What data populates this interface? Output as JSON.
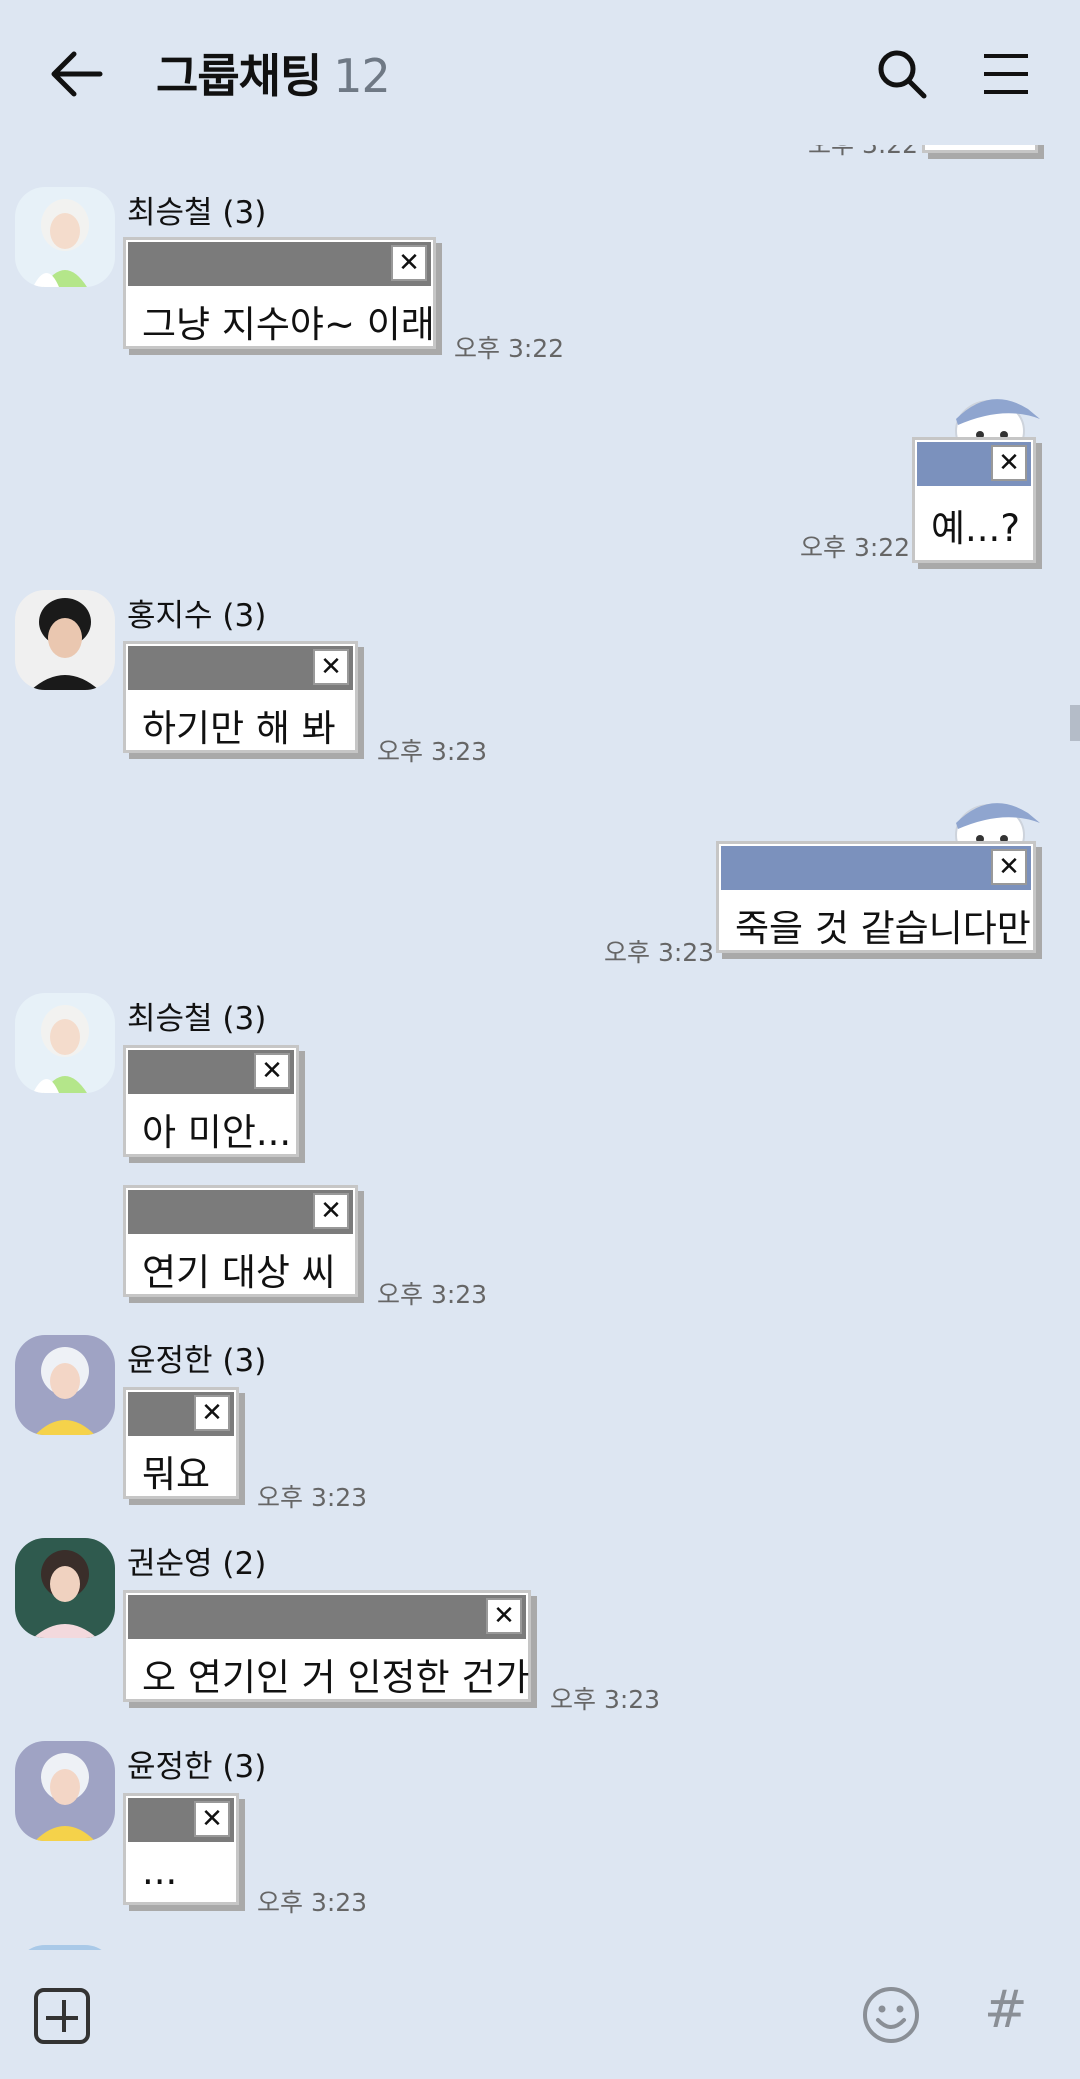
{
  "header": {
    "title": "그룹채팅",
    "member_count": "12"
  },
  "partial_top_time": "오후 3:22",
  "messages": [
    {
      "sender": "최승철 (3)",
      "texts": [
        "그냥 지수야~ 이래"
      ],
      "time": "오후 3:22"
    },
    {
      "mine": true,
      "texts": [
        "예...?"
      ],
      "time": "오후 3:22"
    },
    {
      "sender": "홍지수 (3)",
      "texts": [
        "하기만 해 봐"
      ],
      "time": "오후 3:23"
    },
    {
      "mine": true,
      "texts": [
        "죽을 것 같습니다만"
      ],
      "time": "오후 3:23"
    },
    {
      "sender": "최승철 (3)",
      "texts": [
        "아 미안...",
        "연기 대상 씨"
      ],
      "time": "오후 3:23"
    },
    {
      "sender": "윤정한 (3)",
      "texts": [
        "뭐요"
      ],
      "time": "오후 3:23"
    },
    {
      "sender": "권순영 (2)",
      "texts": [
        "오 연기인 거 인정한 건가"
      ],
      "time": "오후 3:23"
    },
    {
      "sender": "윤정한 (3)",
      "texts": [
        "..."
      ],
      "time": "오후 3:23"
    }
  ],
  "icons": {
    "back": "back-arrow-icon",
    "search": "search-icon",
    "menu": "menu-icon",
    "add": "plus-square-icon",
    "emoji": "emoji-icon",
    "hashtag": "hashtag-icon"
  },
  "bottom": {
    "hashtag_label": "#"
  },
  "colors": {
    "background": "#dde6f2",
    "other_bar": "#7b7b7b",
    "my_bar": "#7b91bd"
  }
}
